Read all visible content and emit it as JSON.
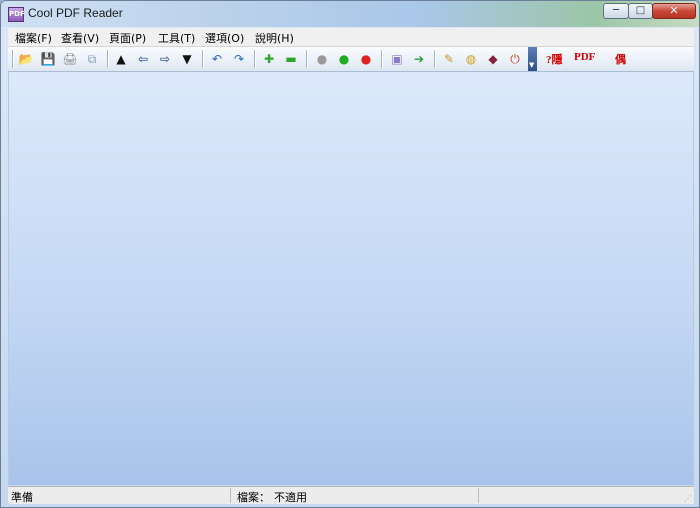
{
  "window": {
    "title": "Cool PDF Reader",
    "icon": "app-icon"
  },
  "controls": {
    "minimize": "─",
    "maximize": "□",
    "close": "✕"
  },
  "menu": [
    {
      "label": "檔案(F)"
    },
    {
      "label": "查看(V)"
    },
    {
      "label": "頁面(P)"
    },
    {
      "label": "工具(T)"
    },
    {
      "label": "選項(O)"
    },
    {
      "label": "說明(H)"
    }
  ],
  "toolbar": {
    "icons": [
      {
        "name": "open-folder-icon",
        "glyph": "📂",
        "color": "#e0a020"
      },
      {
        "name": "save-icon",
        "glyph": "💾",
        "color": "#3d5fa8"
      },
      {
        "name": "print-icon",
        "glyph": "🖨",
        "color": "#8a8a8a"
      },
      {
        "name": "copy-icon",
        "glyph": "⧉",
        "color": "#8aa0c0"
      },
      {
        "name": "first-page-icon",
        "glyph": "▲",
        "color": "#111111"
      },
      {
        "name": "back-icon",
        "glyph": "⇦",
        "color": "#1a3f8a"
      },
      {
        "name": "forward-icon",
        "glyph": "⇨",
        "color": "#1a3f8a"
      },
      {
        "name": "last-page-icon",
        "glyph": "▼",
        "color": "#111111"
      },
      {
        "name": "undo-icon",
        "glyph": "↶",
        "color": "#2563c9"
      },
      {
        "name": "redo-icon",
        "glyph": "↷",
        "color": "#2563c9"
      },
      {
        "name": "zoom-in-icon",
        "glyph": "✚",
        "color": "#2aa82a"
      },
      {
        "name": "zoom-out-icon",
        "glyph": "▬",
        "color": "#2aa82a"
      },
      {
        "name": "gray-dot-icon",
        "glyph": "●",
        "color": "#9a9a9a"
      },
      {
        "name": "green-dot-icon",
        "glyph": "●",
        "color": "#22aa22"
      },
      {
        "name": "red-dot-icon",
        "glyph": "●",
        "color": "#dd2222"
      },
      {
        "name": "image-icon",
        "glyph": "▣",
        "color": "#8a7cc8"
      },
      {
        "name": "export-arrow-icon",
        "glyph": "➔",
        "color": "#20a040"
      },
      {
        "name": "tools-icon",
        "glyph": "✎",
        "color": "#c09a30"
      },
      {
        "name": "globe-icon",
        "glyph": "◍",
        "color": "#d0a020"
      },
      {
        "name": "book-icon",
        "glyph": "◆",
        "color": "#8a2040"
      },
      {
        "name": "power-icon",
        "glyph": "⏻",
        "color": "#d0441f"
      }
    ],
    "overflow": "▼",
    "red_labels": [
      "?隱",
      "PDF",
      "偶"
    ]
  },
  "status": {
    "left": "準備",
    "file_label": "檔案：",
    "file_value": "不適用"
  }
}
